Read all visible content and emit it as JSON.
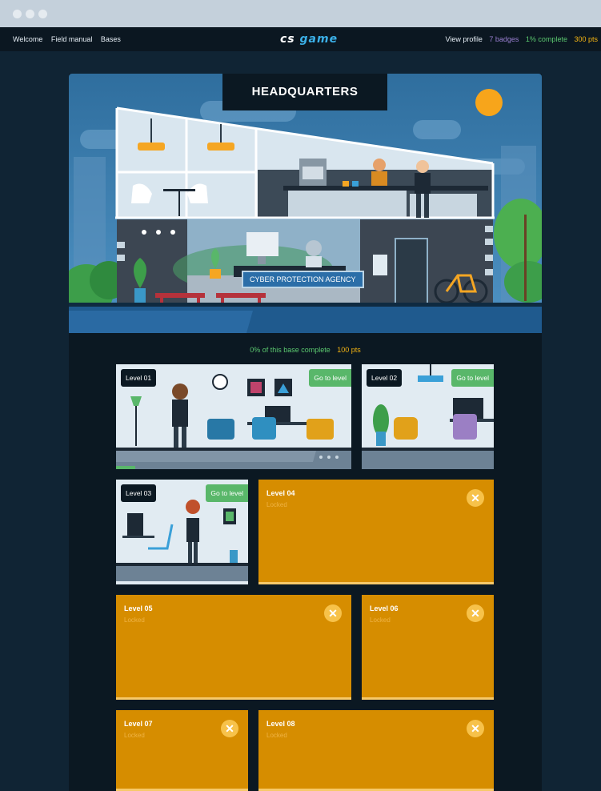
{
  "nav": {
    "links": [
      "Welcome",
      "Field manual",
      "Bases"
    ],
    "logo_a": "cs",
    "logo_b": "game",
    "view_profile": "View profile",
    "badges": "7 badges",
    "complete": "1% complete",
    "points": "300 pts"
  },
  "hq": {
    "title": "HEADQUARTERS",
    "sign": "CYBER PROTECTION AGENCY"
  },
  "progress": {
    "complete": "0% of this base complete",
    "points": "100 pts"
  },
  "levels": [
    {
      "label": "Level 01",
      "action": "Go to level"
    },
    {
      "label": "Level 02",
      "action": "Go to level"
    },
    {
      "label": "Level 03",
      "action": "Go to level"
    },
    {
      "label": "Level 04",
      "status": "Locked"
    },
    {
      "label": "Level 05",
      "status": "Locked"
    },
    {
      "label": "Level 06",
      "status": "Locked"
    },
    {
      "label": "Level 07",
      "status": "Locked"
    },
    {
      "label": "Level 08",
      "status": "Locked"
    }
  ],
  "colors": {
    "accent_green": "#59b76a",
    "locked_orange": "#d68d00",
    "points_yellow": "#f5b512",
    "badges_purple": "#9a7fd1"
  }
}
